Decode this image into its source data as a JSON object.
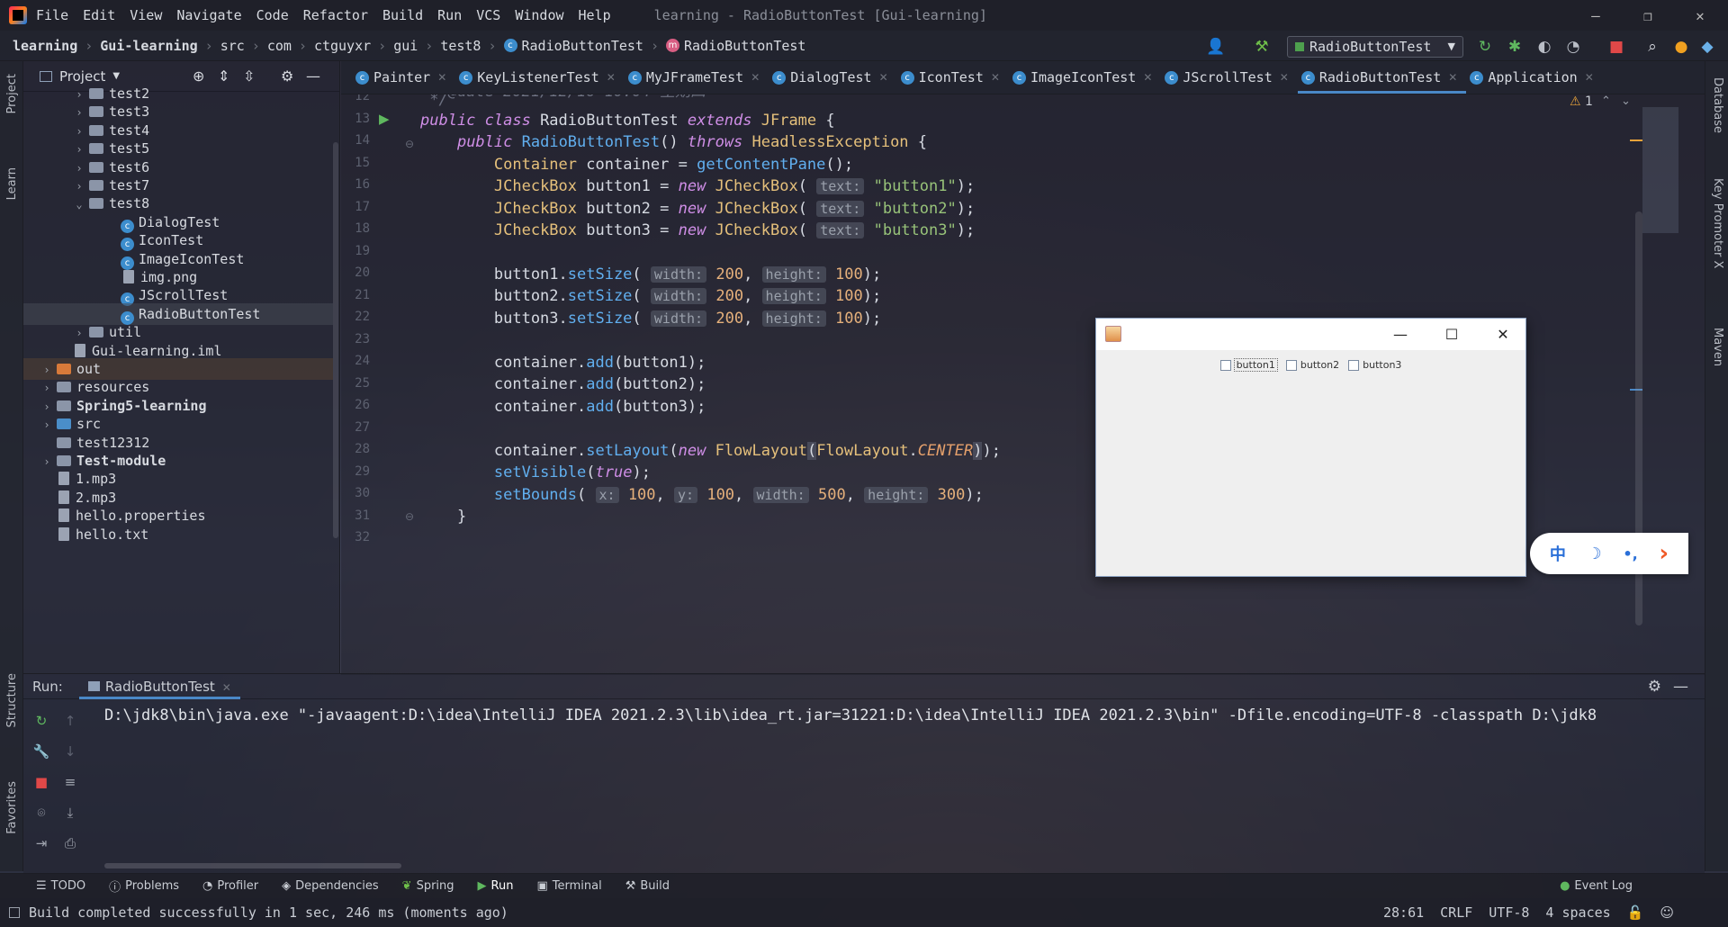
{
  "app": {
    "menu": [
      "File",
      "Edit",
      "View",
      "Navigate",
      "Code",
      "Refactor",
      "Build",
      "Run",
      "VCS",
      "Window",
      "Help"
    ],
    "window_title": "learning - RadioButtonTest [Gui-learning]",
    "win_controls": {
      "minimize": "—",
      "maximize": "❐",
      "close": "✕"
    }
  },
  "breadcrumb": {
    "items": [
      "learning",
      "Gui-learning",
      "src",
      "com",
      "ctguyxr",
      "gui",
      "test8",
      "RadioButtonTest",
      "RadioButtonTest"
    ]
  },
  "toolbar": {
    "run_config": "RadioButtonTest",
    "icons": [
      "user-icon",
      "build-hammer-icon",
      "run-icon",
      "debug-icon",
      "coverage-icon",
      "profile-icon",
      "stop-icon",
      "search-icon",
      "update-icon",
      "plugin-icon"
    ]
  },
  "left_stripe": {
    "project": "Project",
    "learn": "Learn",
    "structure": "Structure",
    "favorites": "Favorites"
  },
  "right_stripe": {
    "database": "Database",
    "key_promoter": "Key Promoter X",
    "maven": "Maven"
  },
  "project_panel": {
    "title": "Project",
    "tree": [
      {
        "label": "test2",
        "type": "folder",
        "depth": 1,
        "arrow": "›"
      },
      {
        "label": "test3",
        "type": "folder",
        "depth": 1,
        "arrow": "›"
      },
      {
        "label": "test4",
        "type": "folder",
        "depth": 1,
        "arrow": "›"
      },
      {
        "label": "test5",
        "type": "folder",
        "depth": 1,
        "arrow": "›"
      },
      {
        "label": "test6",
        "type": "folder",
        "depth": 1,
        "arrow": "›"
      },
      {
        "label": "test7",
        "type": "folder",
        "depth": 1,
        "arrow": "›"
      },
      {
        "label": "test8",
        "type": "folder",
        "depth": 1,
        "arrow": "⌄"
      },
      {
        "label": "DialogTest",
        "type": "class",
        "depth": 2,
        "arrow": ""
      },
      {
        "label": "IconTest",
        "type": "class",
        "depth": 2,
        "arrow": ""
      },
      {
        "label": "ImageIconTest",
        "type": "class",
        "depth": 2,
        "arrow": ""
      },
      {
        "label": "img.png",
        "type": "file",
        "depth": 2,
        "arrow": ""
      },
      {
        "label": "JScrollTest",
        "type": "class",
        "depth": 2,
        "arrow": ""
      },
      {
        "label": "RadioButtonTest",
        "type": "class",
        "depth": 2,
        "arrow": "",
        "selected": true
      },
      {
        "label": "util",
        "type": "folder",
        "depth": 1,
        "arrow": "›"
      },
      {
        "label": "Gui-learning.iml",
        "type": "file",
        "depth": 0.5,
        "arrow": ""
      },
      {
        "label": "out",
        "type": "folder-orange",
        "depth": 0,
        "arrow": "›",
        "hl": true
      },
      {
        "label": "resources",
        "type": "folder",
        "depth": 0,
        "arrow": "›"
      },
      {
        "label": "Spring5-learning",
        "type": "folder",
        "depth": 0,
        "arrow": "›",
        "bold": true
      },
      {
        "label": "src",
        "type": "folder-blue",
        "depth": 0,
        "arrow": "›"
      },
      {
        "label": "test12312",
        "type": "folder",
        "depth": 0,
        "arrow": ""
      },
      {
        "label": "Test-module",
        "type": "folder",
        "depth": 0,
        "arrow": "›",
        "bold": true
      },
      {
        "label": "1.mp3",
        "type": "file",
        "depth": 0,
        "arrow": ""
      },
      {
        "label": "2.mp3",
        "type": "file",
        "depth": 0,
        "arrow": ""
      },
      {
        "label": "hello.properties",
        "type": "file",
        "depth": 0,
        "arrow": ""
      },
      {
        "label": "hello.txt",
        "type": "file",
        "depth": 0,
        "arrow": ""
      }
    ]
  },
  "editor_tabs": [
    "Painter",
    "KeyListenerTest",
    "MyJFrameTest",
    "DialogTest",
    "IconTest",
    "ImageIconTest",
    "JScrollTest",
    "RadioButtonTest",
    "Application"
  ],
  "active_tab": "RadioButtonTest",
  "inspections": {
    "warnings": "1"
  },
  "editor": {
    "line_numbers": [
      "12",
      "13",
      "14",
      "15",
      "16",
      "17",
      "18",
      "19",
      "20",
      "21",
      "22",
      "23",
      "24",
      "25",
      "26",
      "27",
      "28",
      "29",
      "30",
      "31",
      "32"
    ]
  },
  "java_window": {
    "buttons": [
      "button1",
      "button2",
      "button3"
    ]
  },
  "ime": {
    "lang": "中",
    "moon": "☽",
    "punct": "•,",
    "arrow": "›"
  },
  "run_panel": {
    "label": "Run:",
    "tab": "RadioButtonTest",
    "output": "D:\\jdk8\\bin\\java.exe \"-javaagent:D:\\idea\\IntelliJ IDEA 2021.2.3\\lib\\idea_rt.jar=31221:D:\\idea\\IntelliJ IDEA 2021.2.3\\bin\" -Dfile.encoding=UTF-8 -classpath D:\\jdk8"
  },
  "bottom_tabs": [
    "TODO",
    "Problems",
    "Profiler",
    "Dependencies",
    "Spring",
    "Run",
    "Terminal",
    "Build"
  ],
  "event_log": "Event Log",
  "status": {
    "message": "Build completed successfully in 1 sec, 246 ms (moments ago)",
    "position": "28:61",
    "line_sep": "CRLF",
    "encoding": "UTF-8",
    "indent": "4 spaces"
  }
}
